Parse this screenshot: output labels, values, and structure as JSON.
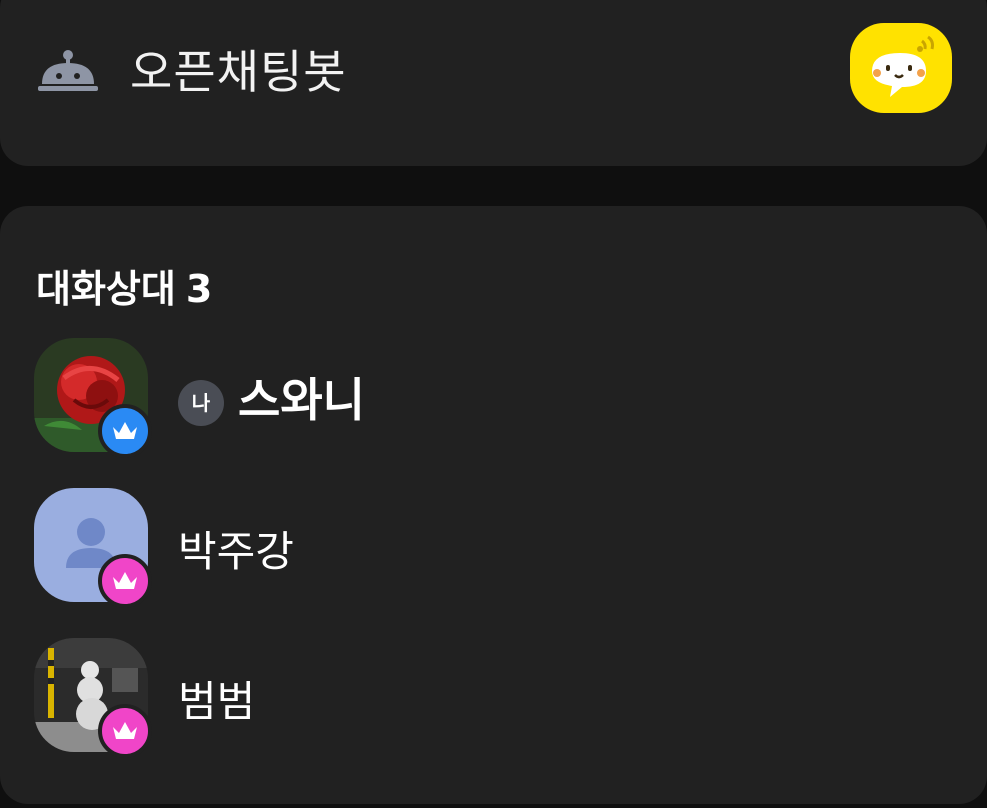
{
  "bot": {
    "title": "오픈채팅봇",
    "icon": "bell-bot-icon",
    "badge_icon": "kakao-bot-icon",
    "badge_color": "#ffe200"
  },
  "members": {
    "heading": "대화상대",
    "count": "3",
    "list": [
      {
        "name": "스와니",
        "me_label": "나",
        "crown_color": "#2a8af4",
        "avatar": "rose-photo"
      },
      {
        "name": "박주강",
        "crown_color": "#f045c8",
        "avatar": "default-profile"
      },
      {
        "name": "범범",
        "crown_color": "#f045c8",
        "avatar": "snowman-photo"
      }
    ]
  },
  "colors": {
    "background": "#0f0f0f",
    "card": "#212121",
    "default_avatar": "#9aaee0"
  }
}
